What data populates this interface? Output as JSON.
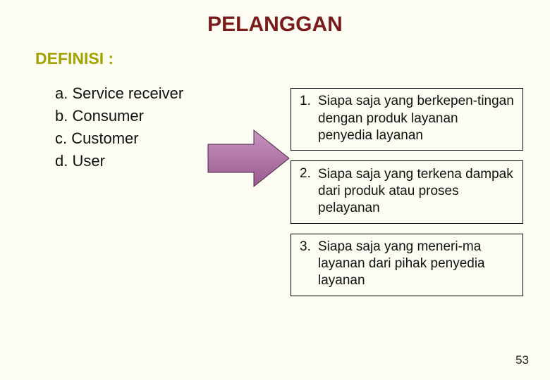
{
  "title": "PELANGGAN",
  "subtitle": "DEFINISI :",
  "terms": {
    "a": "a. Service receiver",
    "b": "b. Consumer",
    "c": "c. Customer",
    "d": "d. User"
  },
  "definitions": {
    "d1_num": "1.",
    "d1_text": "Siapa saja yang berkepen-tingan dengan produk layanan penyedia layanan",
    "d2_num": "2.",
    "d2_text": "Siapa saja yang terkena dampak dari produk atau proses pelayanan",
    "d3_num": "3.",
    "d3_text": "Siapa saja yang meneri-ma layanan dari pihak penyedia layanan"
  },
  "page_number": "53",
  "colors": {
    "title": "#7a1a1a",
    "subtitle": "#a2a200",
    "arrow_fill": "#b06fa8",
    "arrow_stroke": "#4a2a45",
    "background": "#fdfdf4"
  }
}
